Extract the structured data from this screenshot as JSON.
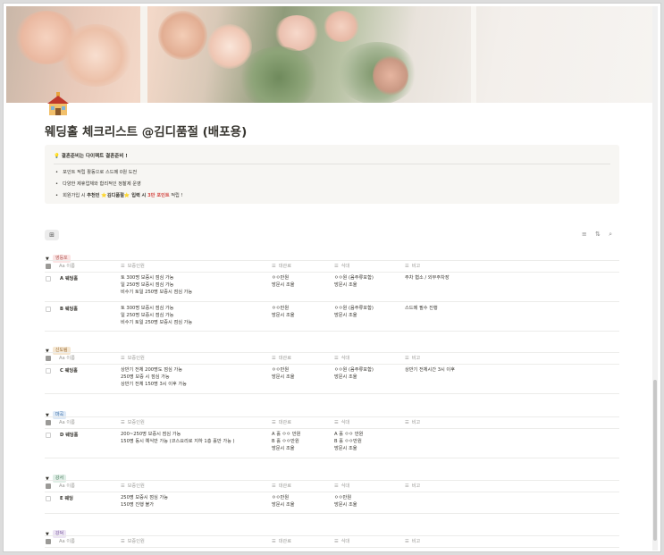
{
  "page": {
    "title": "웨딩홀 체크리스트 @김디품절 (배포용)",
    "icon": "house-icon"
  },
  "callout": {
    "icon": "lightbulb-icon",
    "head": "결혼준비는 다이렉트 결혼준비 !",
    "bullet1": "포인트 적립 활동으로 스드메 0원 도전",
    "bullet2": "다양한 제휴업체와 합리적인 정찰제 운영",
    "bullet3_a": "회원가입 시 ",
    "bullet3_b": "추천인",
    "bullet3_c": " ⭐김디품절⭐ ",
    "bullet3_d": "입력 시 ",
    "bullet3_e": "3만 포인트",
    "bullet3_f": " 적립 !"
  },
  "toolbar": {
    "view_icon": "table-view-icon",
    "filter_icon": "≡",
    "sort_icon": "⇅",
    "search_icon": "⌕"
  },
  "columns": {
    "name": "Aa 이름",
    "guarantee": "보증인원",
    "rental": "대관료",
    "meal": "식대",
    "note": "비고"
  },
  "groups": [
    {
      "tag": "영등포",
      "tag_color": "#fbe4e4",
      "tag_text_color": "#b35d58",
      "rows": [
        {
          "name": "A 웨딩홀",
          "guarantee": [
            "토 300명 보증시 점심 가능",
            "일 250명 보증시 점심 가능",
            "비수기 토일 250명 보증시 점심 가능"
          ],
          "rental": [
            "ㅇㅇ만원",
            "방문시 조율"
          ],
          "meal": [
            "ㅇㅇ원 (음주류포함)",
            "방문시 조율"
          ],
          "note": [
            "주차 협소 / 외부주차장"
          ]
        },
        {
          "name": "B 웨딩홀",
          "guarantee": [
            "토 300명 보증시 점심 가능",
            "일 250명 보증시 점심 가능",
            "비수기 토일 250명 보증시 점심 가능"
          ],
          "rental": [
            "ㅇㅇ만원",
            "방문시 조율"
          ],
          "meal": [
            "ㅇㅇ원 (음주류포함)",
            "방문시 조율"
          ],
          "note": [
            "스드메 필수 진행"
          ]
        }
      ]
    },
    {
      "tag": "신도림",
      "tag_color": "#f5e7d2",
      "tag_text_color": "#9a6b34",
      "rows": [
        {
          "name": "C 웨딩홀",
          "guarantee": [
            "상반기 전체 200명도 점심 가능",
            "250명 보증 시 점심 가능",
            "상반기 전체 150명 3시 이후 가능"
          ],
          "rental": [
            "ㅇㅇ만원",
            "방문시 조율"
          ],
          "meal": [
            "ㅇㅇ원 (음주류포함)",
            "방문시 조율"
          ],
          "note": [
            "상반기 전체시간 3시 이후"
          ]
        }
      ]
    },
    {
      "tag": "마곡",
      "tag_color": "#dde9f7",
      "tag_text_color": "#3a6ea5",
      "rows": [
        {
          "name": "D 웨딩홀",
          "guarantee": [
            "200~250명 보증시 점심 가능",
            "150명 동시 예식만 가능 (코스요리로 지하 1층 홀만 가능 )"
          ],
          "rental": [
            "A 홀 ㅇㅇ 만원",
            "B 홀 ㅇㅇ만원",
            "방문시 조율"
          ],
          "meal": [
            "A 홀 ㅇㅇ 만원",
            "B 홀 ㅇㅇ만원",
            "방문시 조율"
          ],
          "note": []
        }
      ]
    },
    {
      "tag": "강서",
      "tag_color": "#dfeee6",
      "tag_text_color": "#4a7c5e",
      "rows": [
        {
          "name": "E 웨딩",
          "guarantee": [
            "250명 보증시 점심 가능",
            "150명 진행 불가"
          ],
          "rental": [
            "ㅇㅇ만원",
            "방문시 조율"
          ],
          "meal": [
            "ㅇㅇ만원",
            "방문시 조율"
          ],
          "note": []
        }
      ]
    },
    {
      "tag": "강덕",
      "tag_color": "#ece4f4",
      "tag_text_color": "#7a5a9e",
      "rows": []
    }
  ]
}
